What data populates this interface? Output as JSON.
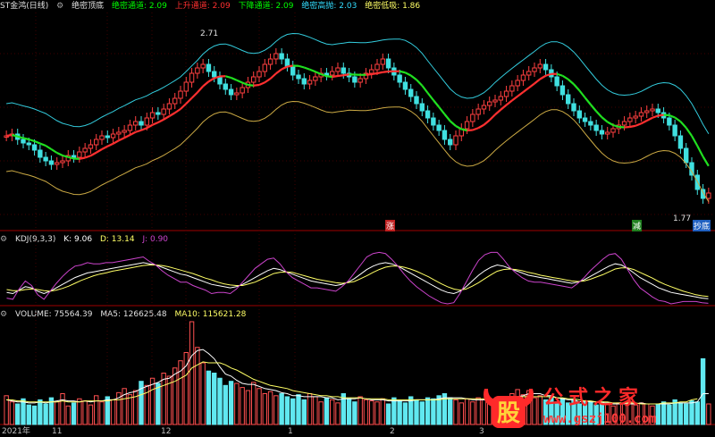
{
  "window": {
    "title": "ST金鸿(日线)"
  },
  "main_legend": {
    "indicator": "绝密顶底",
    "items": [
      {
        "label": "绝密通道: 2.09",
        "color": "#00ff00"
      },
      {
        "label": "上升通道: 2.09",
        "color": "#ff3030"
      },
      {
        "label": "下降通道: 2.09",
        "color": "#00ff00"
      },
      {
        "label": "绝密高抛: 2.03",
        "color": "#33ddff"
      },
      {
        "label": "绝密低吸: 1.86",
        "color": "#ffff66"
      }
    ]
  },
  "kdj_legend": {
    "name": "KDJ(9,3,3)",
    "k": "K: 9.06",
    "d": "D: 13.14",
    "j": "J: 0.90"
  },
  "vol_legend": {
    "name": "VOLUME: 75564.39",
    "ma5": "MA5: 126625.48",
    "ma10": "MA10: 115621.28"
  },
  "annotations": {
    "high": "2.71",
    "low": "1.77",
    "zhang": "涨",
    "jian": "减",
    "chao": "抄底"
  },
  "x_labels": [
    "2021年",
    "11",
    "12",
    "1",
    "2",
    "3"
  ],
  "watermark": {
    "brand": "公式之家",
    "url": "www.gszj100.com",
    "logo_char": "股"
  },
  "chart_data": [
    {
      "type": "candlestick",
      "title": "绝密顶底",
      "y_range": [
        1.6,
        2.8
      ],
      "close": [
        2.12,
        2.13,
        2.1,
        2.08,
        2.07,
        2.04,
        2.0,
        1.98,
        1.96,
        1.97,
        1.98,
        2.01,
        2.0,
        2.03,
        2.05,
        2.07,
        2.1,
        2.12,
        2.11,
        2.13,
        2.14,
        2.15,
        2.18,
        2.2,
        2.18,
        2.22,
        2.25,
        2.24,
        2.27,
        2.3,
        2.33,
        2.37,
        2.42,
        2.47,
        2.5,
        2.52,
        2.48,
        2.45,
        2.41,
        2.38,
        2.35,
        2.36,
        2.39,
        2.42,
        2.45,
        2.48,
        2.52,
        2.55,
        2.58,
        2.55,
        2.51,
        2.46,
        2.44,
        2.41,
        2.43,
        2.45,
        2.47,
        2.46,
        2.48,
        2.5,
        2.47,
        2.45,
        2.42,
        2.44,
        2.47,
        2.49,
        2.52,
        2.55,
        2.5,
        2.46,
        2.42,
        2.38,
        2.34,
        2.3,
        2.26,
        2.22,
        2.18,
        2.15,
        2.1,
        2.07,
        2.12,
        2.16,
        2.2,
        2.24,
        2.27,
        2.29,
        2.31,
        2.32,
        2.34,
        2.37,
        2.4,
        2.43,
        2.46,
        2.48,
        2.5,
        2.52,
        2.49,
        2.45,
        2.4,
        2.35,
        2.3,
        2.26,
        2.22,
        2.2,
        2.18,
        2.15,
        2.13,
        2.14,
        2.16,
        2.18,
        2.2,
        2.22,
        2.23,
        2.25,
        2.26,
        2.27,
        2.25,
        2.22,
        2.18,
        2.12,
        2.05,
        1.97,
        1.9,
        1.82,
        1.77,
        1.8
      ],
      "volume": [
        0.28,
        0.22,
        0.2,
        0.25,
        0.19,
        0.18,
        0.24,
        0.2,
        0.26,
        0.22,
        0.3,
        0.18,
        0.21,
        0.25,
        0.23,
        0.19,
        0.28,
        0.22,
        0.27,
        0.24,
        0.31,
        0.35,
        0.29,
        0.33,
        0.42,
        0.38,
        0.45,
        0.4,
        0.5,
        0.47,
        0.55,
        0.62,
        0.7,
        1.0,
        0.75,
        0.6,
        0.52,
        0.5,
        0.45,
        0.38,
        0.42,
        0.4,
        0.36,
        0.33,
        0.41,
        0.35,
        0.3,
        0.32,
        0.28,
        0.3,
        0.27,
        0.25,
        0.29,
        0.24,
        0.3,
        0.27,
        0.22,
        0.26,
        0.24,
        0.21,
        0.3,
        0.25,
        0.22,
        0.27,
        0.24,
        0.23,
        0.22,
        0.25,
        0.2,
        0.26,
        0.23,
        0.21,
        0.27,
        0.24,
        0.22,
        0.26,
        0.25,
        0.28,
        0.3,
        0.26,
        0.24,
        0.21,
        0.25,
        0.22,
        0.26,
        0.24,
        0.2,
        0.23,
        0.27,
        0.22,
        0.3,
        0.34,
        0.29,
        0.33,
        0.26,
        0.28,
        0.24,
        0.27,
        0.22,
        0.25,
        0.21,
        0.24,
        0.2,
        0.23,
        0.22,
        0.19,
        0.22,
        0.2,
        0.18,
        0.21,
        0.2,
        0.22,
        0.19,
        0.21,
        0.2,
        0.18,
        0.2,
        0.22,
        0.19,
        0.24,
        0.21,
        0.2,
        0.23,
        0.22,
        0.64,
        0.2
      ]
    },
    {
      "type": "line",
      "title": "KDJ(9,3,3)",
      "series": [
        {
          "name": "K",
          "values": [
            20,
            18,
            24,
            30,
            28,
            22,
            18,
            22,
            28,
            34,
            40,
            46,
            50,
            54,
            56,
            58,
            60,
            62,
            64,
            66,
            68,
            70,
            72,
            70,
            68,
            64,
            60,
            56,
            52,
            50,
            46,
            42,
            38,
            34,
            32,
            30,
            28,
            30,
            34,
            40,
            46,
            52,
            58,
            62,
            60,
            56,
            52,
            48,
            44,
            40,
            38,
            36,
            34,
            32,
            34,
            38,
            44,
            52,
            60,
            66,
            70,
            72,
            70,
            66,
            60,
            54,
            48,
            42,
            36,
            30,
            24,
            20,
            18,
            22,
            30,
            40,
            50,
            58,
            64,
            68,
            66,
            62,
            58,
            54,
            50,
            48,
            46,
            44,
            42,
            40,
            38,
            36,
            38,
            42,
            48,
            54,
            60,
            66,
            70,
            68,
            62,
            54,
            46,
            40,
            34,
            28,
            24,
            20,
            18,
            16,
            14,
            12,
            10,
            9
          ]
        },
        {
          "name": "D",
          "values": [
            25,
            23,
            23,
            25,
            26,
            25,
            23,
            22,
            24,
            27,
            31,
            36,
            41,
            45,
            49,
            52,
            54,
            57,
            59,
            61,
            63,
            65,
            67,
            68,
            68,
            67,
            65,
            62,
            59,
            56,
            53,
            49,
            45,
            42,
            38,
            35,
            33,
            32,
            32,
            35,
            38,
            43,
            48,
            53,
            55,
            56,
            55,
            52,
            49,
            46,
            43,
            41,
            39,
            37,
            36,
            37,
            39,
            44,
            49,
            55,
            60,
            64,
            66,
            66,
            64,
            61,
            57,
            52,
            47,
            41,
            35,
            30,
            26,
            24,
            26,
            31,
            37,
            44,
            51,
            57,
            60,
            61,
            60,
            58,
            55,
            53,
            50,
            48,
            46,
            44,
            42,
            40,
            39,
            40,
            43,
            47,
            51,
            56,
            61,
            63,
            63,
            60,
            55,
            50,
            45,
            39,
            34,
            30,
            26,
            22,
            19,
            16,
            14,
            13
          ]
        },
        {
          "name": "J",
          "values": [
            10,
            8,
            26,
            40,
            32,
            16,
            8,
            22,
            36,
            48,
            58,
            66,
            68,
            72,
            70,
            70,
            72,
            72,
            74,
            76,
            78,
            80,
            82,
            74,
            68,
            58,
            50,
            44,
            38,
            38,
            32,
            28,
            24,
            18,
            20,
            20,
            18,
            26,
            38,
            50,
            62,
            70,
            78,
            80,
            70,
            56,
            46,
            40,
            34,
            28,
            28,
            26,
            24,
            22,
            30,
            40,
            54,
            68,
            82,
            88,
            90,
            88,
            78,
            66,
            52,
            40,
            30,
            22,
            14,
            8,
            2,
            0,
            2,
            18,
            38,
            58,
            76,
            86,
            90,
            90,
            78,
            64,
            54,
            46,
            40,
            38,
            38,
            36,
            34,
            32,
            30,
            28,
            36,
            46,
            58,
            68,
            78,
            86,
            88,
            78,
            60,
            42,
            28,
            20,
            12,
            6,
            4,
            0,
            2,
            4,
            4,
            4,
            2,
            1
          ]
        }
      ]
    },
    {
      "type": "bar",
      "title": "VOLUME",
      "series": [
        {
          "name": "MA5",
          "values": [
            0.24,
            0.23,
            0.22,
            0.22,
            0.21,
            0.21,
            0.22,
            0.21,
            0.22,
            0.23,
            0.24,
            0.23,
            0.23,
            0.22,
            0.23,
            0.22,
            0.23,
            0.23,
            0.24,
            0.24,
            0.26,
            0.29,
            0.31,
            0.32,
            0.35,
            0.37,
            0.39,
            0.41,
            0.44,
            0.45,
            0.49,
            0.52,
            0.57,
            0.67,
            0.72,
            0.73,
            0.69,
            0.64,
            0.56,
            0.49,
            0.47,
            0.43,
            0.4,
            0.39,
            0.39,
            0.37,
            0.35,
            0.34,
            0.33,
            0.31,
            0.3,
            0.28,
            0.28,
            0.27,
            0.27,
            0.27,
            0.27,
            0.26,
            0.26,
            0.24,
            0.25,
            0.25,
            0.25,
            0.26,
            0.25,
            0.24,
            0.24,
            0.24,
            0.23,
            0.23,
            0.23,
            0.23,
            0.23,
            0.24,
            0.24,
            0.24,
            0.24,
            0.25,
            0.26,
            0.26,
            0.26,
            0.26,
            0.25,
            0.24,
            0.24,
            0.24,
            0.23,
            0.23,
            0.24,
            0.24,
            0.25,
            0.27,
            0.28,
            0.3,
            0.3,
            0.3,
            0.28,
            0.28,
            0.26,
            0.25,
            0.24,
            0.24,
            0.22,
            0.23,
            0.22,
            0.22,
            0.21,
            0.21,
            0.2,
            0.2,
            0.2,
            0.2,
            0.2,
            0.21,
            0.2,
            0.2,
            0.2,
            0.2,
            0.2,
            0.21,
            0.21,
            0.21,
            0.21,
            0.22,
            0.3,
            0.3
          ]
        },
        {
          "name": "MA10",
          "values": [
            0.24,
            0.24,
            0.23,
            0.23,
            0.22,
            0.22,
            0.22,
            0.22,
            0.22,
            0.22,
            0.23,
            0.22,
            0.22,
            0.22,
            0.23,
            0.23,
            0.23,
            0.23,
            0.23,
            0.24,
            0.24,
            0.25,
            0.26,
            0.27,
            0.29,
            0.31,
            0.34,
            0.36,
            0.38,
            0.4,
            0.42,
            0.45,
            0.48,
            0.55,
            0.58,
            0.61,
            0.6,
            0.6,
            0.6,
            0.58,
            0.55,
            0.53,
            0.5,
            0.47,
            0.44,
            0.42,
            0.4,
            0.38,
            0.37,
            0.36,
            0.35,
            0.33,
            0.32,
            0.31,
            0.3,
            0.29,
            0.28,
            0.28,
            0.27,
            0.27,
            0.26,
            0.26,
            0.26,
            0.26,
            0.25,
            0.25,
            0.25,
            0.25,
            0.24,
            0.24,
            0.24,
            0.24,
            0.24,
            0.24,
            0.24,
            0.24,
            0.24,
            0.24,
            0.25,
            0.25,
            0.25,
            0.25,
            0.25,
            0.25,
            0.25,
            0.25,
            0.24,
            0.24,
            0.24,
            0.24,
            0.25,
            0.26,
            0.27,
            0.27,
            0.27,
            0.27,
            0.27,
            0.27,
            0.26,
            0.26,
            0.25,
            0.25,
            0.24,
            0.23,
            0.23,
            0.22,
            0.22,
            0.22,
            0.21,
            0.21,
            0.21,
            0.21,
            0.21,
            0.2,
            0.2,
            0.2,
            0.2,
            0.21,
            0.21,
            0.21,
            0.22,
            0.22,
            0.24,
            0.25
          ]
        }
      ]
    }
  ]
}
